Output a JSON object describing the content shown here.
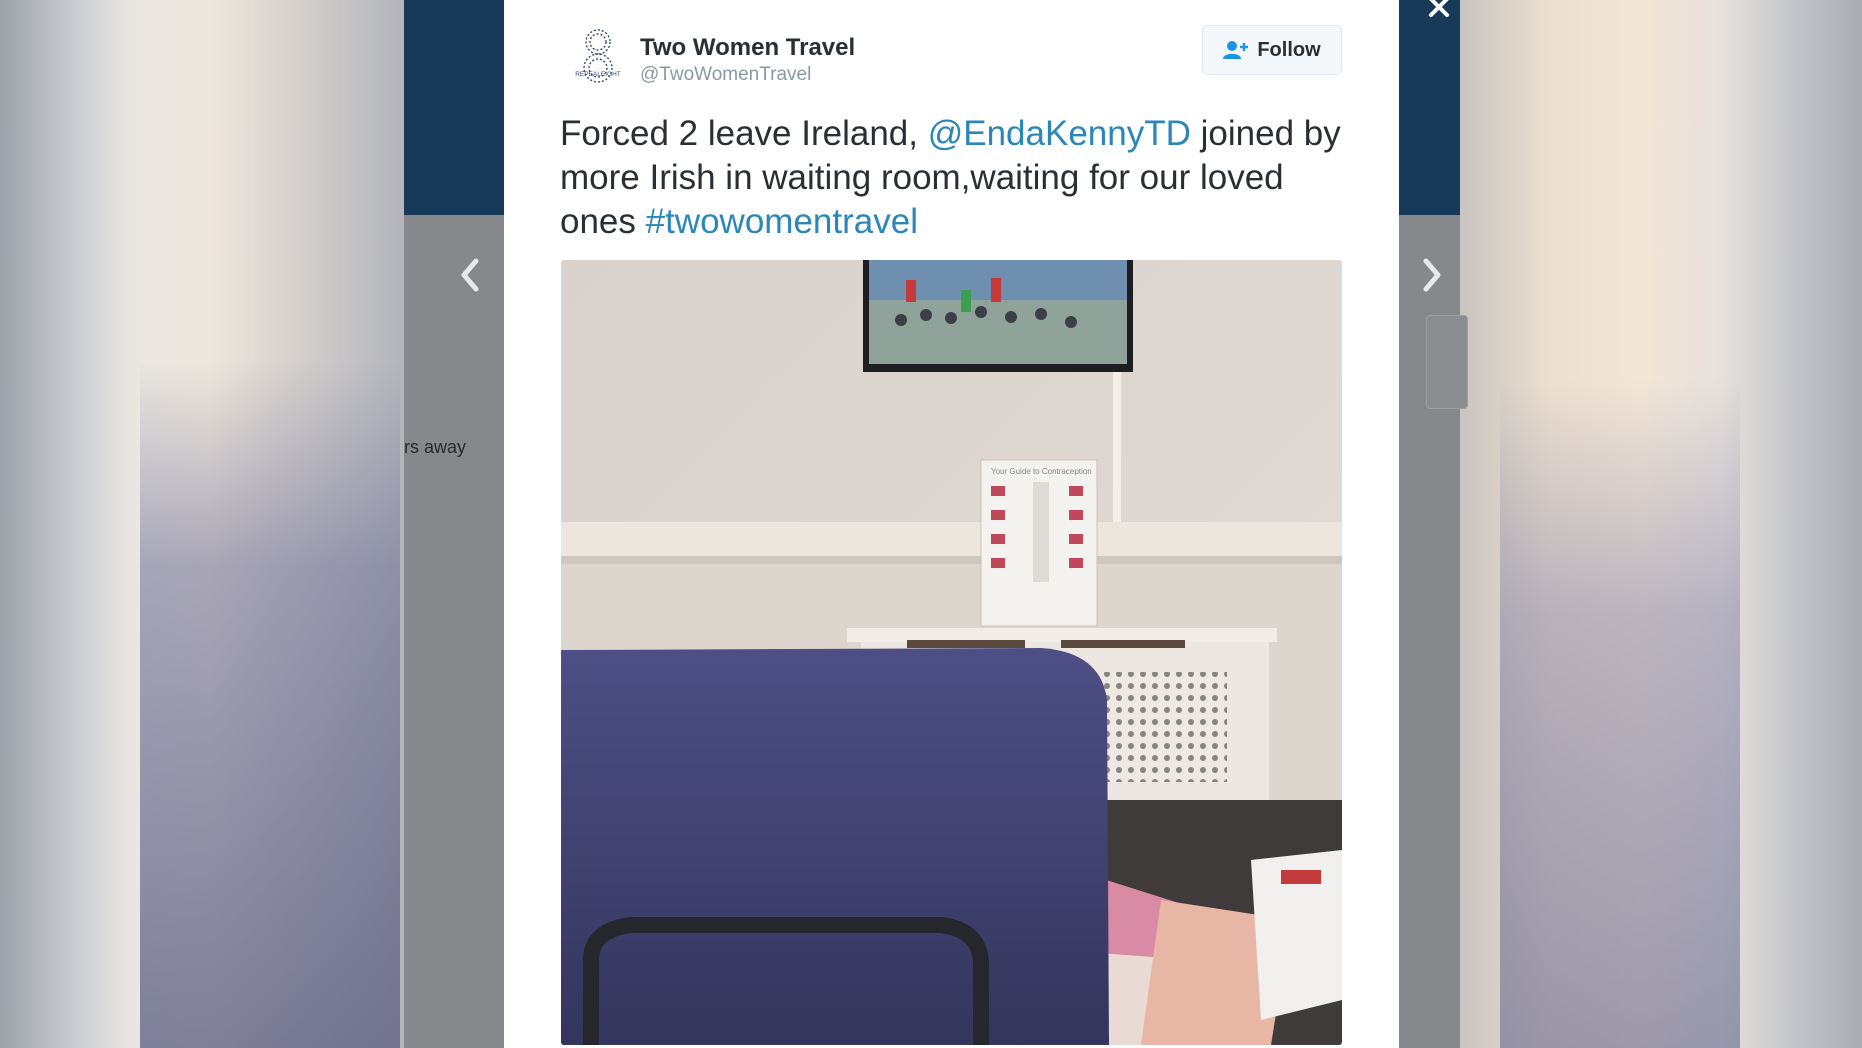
{
  "background_page": {
    "partial_text": "rs away"
  },
  "modal": {
    "close_label": "×"
  },
  "tweet": {
    "display_name": "Two Women Travel",
    "handle": "@TwoWomenTravel",
    "avatar_text": "REPEALEIGHT",
    "follow_label": "Follow",
    "text_parts": {
      "part1": "Forced 2 leave Ireland, ",
      "mention": "@EndaKennyTD",
      "part2": " joined by more Irish in waiting room,waiting for our loved ones ",
      "hashtag": "#twowomentravel"
    },
    "photo_poster_title": "Your Guide to Contraception"
  },
  "colors": {
    "header_navy": "#173a59",
    "link_blue": "#2a87b8",
    "text_dark": "#292f33",
    "text_muted": "#8899a6"
  },
  "icons": {
    "prev": "chevron-left-icon",
    "next": "chevron-right-icon",
    "close": "close-icon",
    "follow": "add-user-icon"
  }
}
